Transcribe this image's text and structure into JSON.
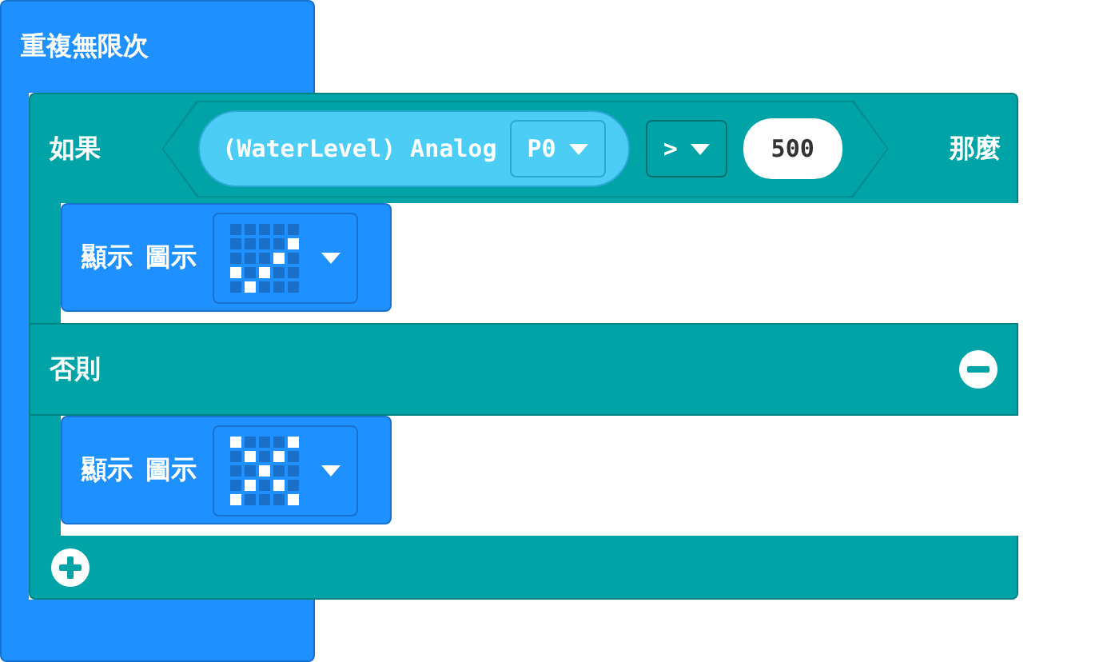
{
  "forever": {
    "label": "重複無限次"
  },
  "if_block": {
    "label": "如果",
    "then_label": "那麼",
    "else_label": "否則",
    "condition": {
      "sensor": "(WaterLevel) Analog",
      "pin": "P0",
      "operator": ">",
      "value": "500"
    },
    "then_body": [
      {
        "kind": "show_icon",
        "label": "顯示",
        "icon_label": "圖示",
        "leds": [
          [
            false,
            false,
            false,
            false,
            false
          ],
          [
            false,
            false,
            false,
            false,
            true
          ],
          [
            false,
            false,
            false,
            true,
            false
          ],
          [
            true,
            false,
            true,
            false,
            false
          ],
          [
            false,
            true,
            false,
            false,
            false
          ]
        ]
      }
    ],
    "else_body": [
      {
        "kind": "show_icon",
        "label": "顯示",
        "icon_label": "圖示",
        "leds": [
          [
            true,
            false,
            false,
            false,
            true
          ],
          [
            false,
            true,
            false,
            true,
            false
          ],
          [
            false,
            false,
            true,
            false,
            false
          ],
          [
            false,
            true,
            false,
            true,
            false
          ],
          [
            true,
            false,
            false,
            false,
            true
          ]
        ]
      }
    ]
  }
}
